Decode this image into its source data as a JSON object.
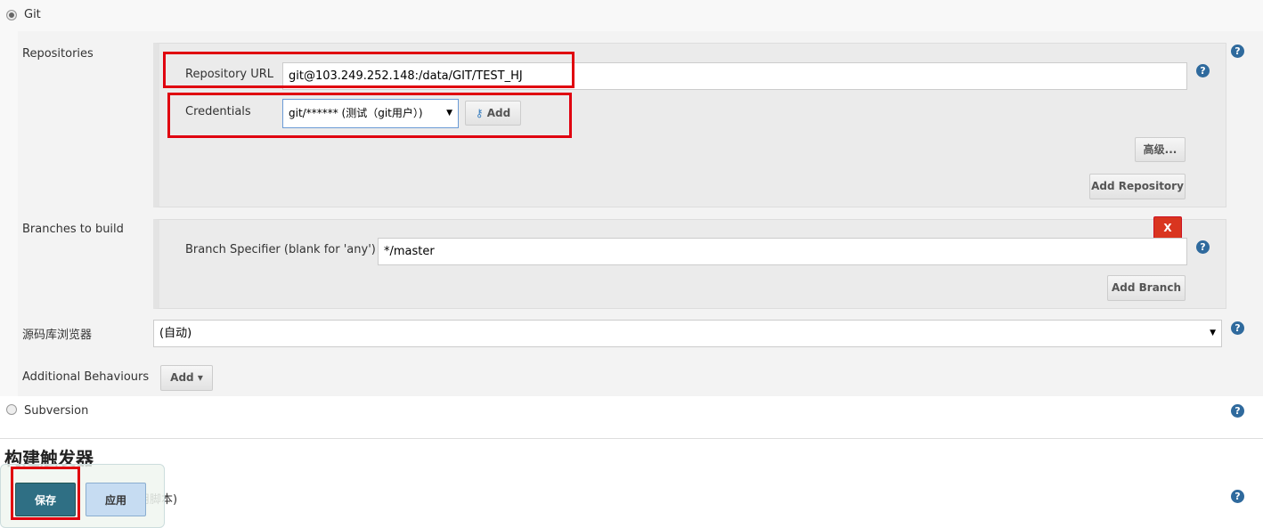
{
  "scm": {
    "git_label": "Git",
    "subversion_label": "Subversion"
  },
  "repositories": {
    "label": "Repositories",
    "url_label": "Repository URL",
    "url_value": "git@103.249.252.148:/data/GIT/TEST_HJ",
    "credentials_label": "Credentials",
    "credentials_value": "git/****** (测试（git用户）)",
    "add_label": "Add",
    "advanced_label": "高级...",
    "add_repository_label": "Add Repository"
  },
  "branches": {
    "label": "Branches to build",
    "specifier_label": "Branch Specifier (blank for 'any')",
    "specifier_value": "*/master",
    "delete_label": "X",
    "add_branch_label": "Add Branch"
  },
  "browser": {
    "label": "源码库浏览器",
    "value": "(自动)"
  },
  "behaviours": {
    "label": "Additional Behaviours",
    "add_label": "Add"
  },
  "triggers": {
    "heading": "构建触发器",
    "partial_text": "用脚本)"
  },
  "footer": {
    "save_label": "保存",
    "apply_label": "应用"
  },
  "help_icon": "?"
}
